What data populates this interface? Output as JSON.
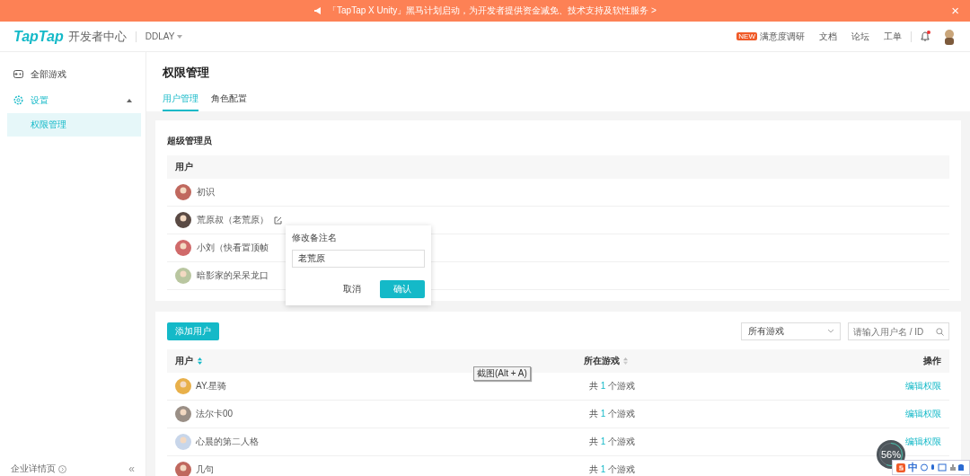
{
  "banner": {
    "text": "「TapTap X Unity」黑马计划启动，为开发者提供资金减免、技术支持及软性服务 >",
    "close": "×"
  },
  "header": {
    "logo": "TapTap",
    "subtitle": "开发者中心",
    "account": "DDLAY",
    "links": [
      {
        "text": "满意度调研",
        "badge": "NEW"
      },
      {
        "text": "文档"
      },
      {
        "text": "论坛"
      },
      {
        "text": "工单"
      }
    ],
    "unread": true
  },
  "sidebar": {
    "items": [
      {
        "label": "全部游戏",
        "kind": "games",
        "selected": false
      },
      {
        "label": "设置",
        "kind": "settings",
        "expanded": true,
        "selected": true,
        "children": [
          {
            "label": "权限管理",
            "selected": true
          }
        ]
      }
    ],
    "footer": "企业详情页",
    "collapse": "«"
  },
  "page": {
    "title": "权限管理",
    "tabs": [
      {
        "label": "用户管理",
        "selected": true
      },
      {
        "label": "角色配置",
        "selected": false
      }
    ]
  },
  "super_admins": {
    "title": "超级管理员",
    "column": "用户",
    "rows": [
      {
        "name": "初识",
        "editable": false
      },
      {
        "name": "荒原叔（老荒原）",
        "editable": true
      },
      {
        "name": "小刘（快看置顶帧",
        "editable": false
      },
      {
        "name": "暗影家的呆呆龙口",
        "editable": false
      }
    ]
  },
  "popover": {
    "title": "修改备注名",
    "value": "老荒原",
    "cancel": "取消",
    "confirm": "确认"
  },
  "users": {
    "add_button": "添加用户",
    "filter": "所有游戏",
    "search_placeholder": "请输入用户名 / ID",
    "columns": [
      {
        "label": "用户",
        "sortable": true,
        "sort_active": true
      },
      {
        "label": "所在游戏",
        "sortable": true,
        "sort_active": false
      },
      {
        "label": "操作",
        "sortable": false
      }
    ],
    "rows": [
      {
        "name": "AY.星骑",
        "games_prefix": "共",
        "games_count": "1",
        "games_suffix": "个游戏",
        "action": "编辑权限"
      },
      {
        "name": "法尔卡00",
        "games_prefix": "共",
        "games_count": "1",
        "games_suffix": "个游戏",
        "action": "编辑权限"
      },
      {
        "name": "心晨的第二人格",
        "games_prefix": "共",
        "games_count": "1",
        "games_suffix": "个游戏",
        "action": "编辑权限"
      },
      {
        "name": "几句",
        "games_prefix": "共",
        "games_count": "1",
        "games_suffix": "个游戏"
      }
    ]
  },
  "tooltip": "截图(Alt + A)",
  "gauge": {
    "reading": "56%",
    "level": 0.56
  },
  "ime": {
    "mode": "中"
  }
}
